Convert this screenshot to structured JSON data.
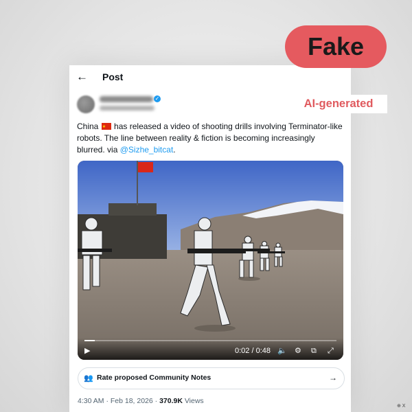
{
  "header": {
    "title": "Post"
  },
  "tweet": {
    "text_part1": "China",
    "text_part2": "has released a video of shooting drills involving Terminator-like robots. The line between reality & fiction is becoming increasingly blurred. via",
    "mention": "@Sizhe_bitcat",
    "text_end": ".",
    "flag": "china-flag"
  },
  "video": {
    "time": "0:02 / 0:48",
    "progress": 0.04
  },
  "community_notes": {
    "label": "Rate proposed Community Notes"
  },
  "meta": {
    "timestamp": "4:30 AM · Feb 18, 2026 · ",
    "views_count": "370.9K",
    "views_label": " Views"
  },
  "overlay": {
    "badge": "Fake",
    "label": "AI-generated",
    "badge_color": "#e55a5f",
    "label_color": "#e05a5e"
  },
  "watermark": "⊕ X",
  "colors": {
    "link": "#1d9bf0",
    "text": "#0f1419",
    "muted": "#536471"
  }
}
